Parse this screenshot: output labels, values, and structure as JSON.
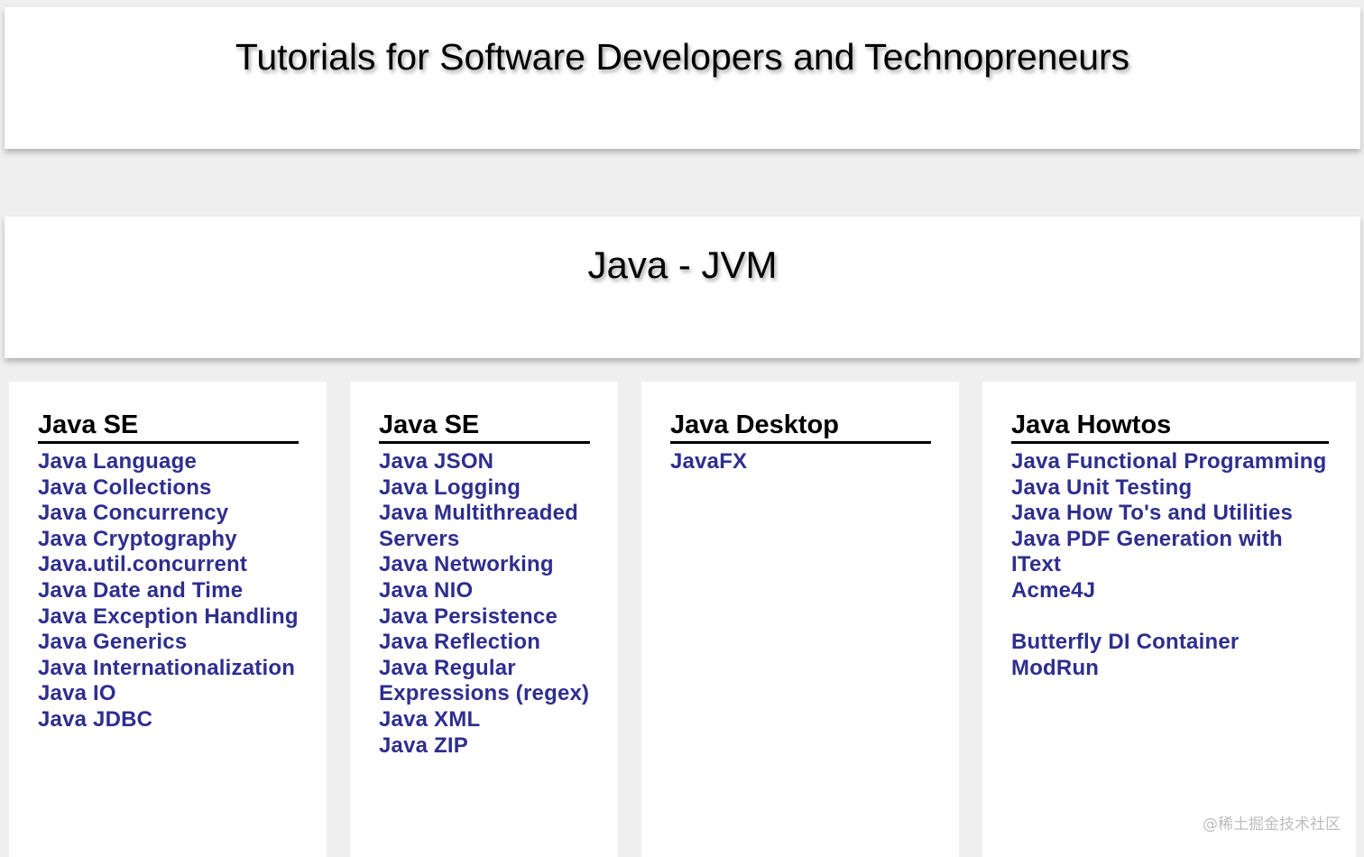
{
  "header": {
    "title": "Tutorials for Software Developers and Technopreneurs"
  },
  "page": {
    "title": "Java - JVM"
  },
  "columns": [
    {
      "title": "Java SE",
      "links": [
        "Java Language",
        "Java Collections",
        "Java Concurrency",
        "Java Cryptography",
        "Java.util.concurrent",
        "Java Date and Time",
        "Java Exception Handling",
        "Java Generics",
        "Java Internationalization",
        "Java IO",
        "Java JDBC"
      ]
    },
    {
      "title": "Java SE",
      "links": [
        "Java JSON",
        "Java Logging",
        "Java Multithreaded Servers",
        "Java Networking",
        "Java NIO",
        "Java Persistence",
        "Java Reflection",
        "Java Regular Expressions (regex)",
        "Java XML",
        "Java ZIP"
      ]
    },
    {
      "title": "Java Desktop",
      "links": [
        "JavaFX"
      ]
    },
    {
      "title": "Java Howtos",
      "links": [
        "Java Functional Programming",
        "Java Unit Testing",
        "Java How To's and Utilities",
        "Java PDF Generation with IText",
        "Acme4J",
        "",
        "Butterfly DI Container",
        "ModRun"
      ]
    }
  ],
  "watermark": "@稀土掘金技术社区"
}
